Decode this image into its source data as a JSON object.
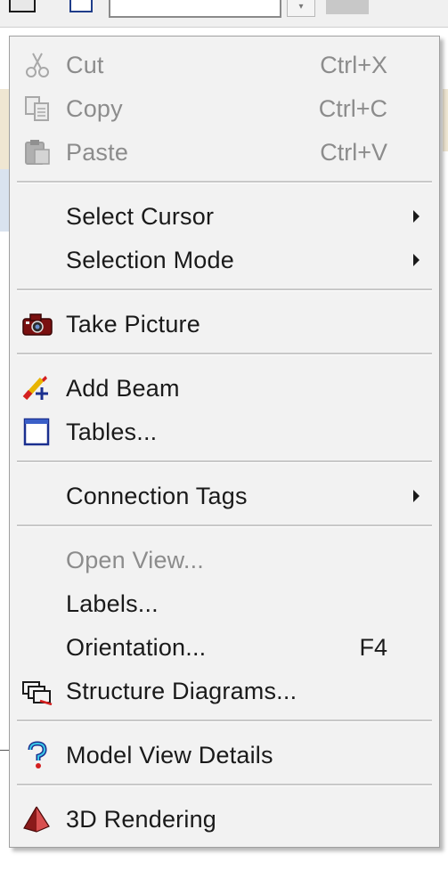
{
  "menu": {
    "items": {
      "cut": {
        "label": "Cut",
        "shortcut": "Ctrl+X"
      },
      "copy": {
        "label": "Copy",
        "shortcut": "Ctrl+C"
      },
      "paste": {
        "label": "Paste",
        "shortcut": "Ctrl+V"
      },
      "select_cursor": {
        "label": "Select Cursor"
      },
      "selection_mode": {
        "label": "Selection Mode"
      },
      "take_picture": {
        "label": "Take Picture"
      },
      "add_beam": {
        "label": "Add Beam"
      },
      "tables": {
        "label": "Tables..."
      },
      "connection_tags": {
        "label": "Connection Tags"
      },
      "open_view": {
        "label": "Open View..."
      },
      "labels": {
        "label": "Labels..."
      },
      "orientation": {
        "label": "Orientation...",
        "shortcut": "F4"
      },
      "structure_diagrams": {
        "label": "Structure Diagrams..."
      },
      "model_view_details": {
        "label": "Model View Details"
      },
      "rendering_3d": {
        "label": "3D Rendering"
      }
    },
    "disabled": [
      "cut",
      "copy",
      "paste",
      "open_view"
    ],
    "icons": {
      "cut": "scissors-icon",
      "copy": "copy-icon",
      "paste": "clipboard-icon",
      "take_picture": "camera-icon",
      "add_beam": "pencil-plus-icon",
      "tables": "table-window-icon",
      "structure_diagrams": "diagram-icon",
      "model_view_details": "help-icon",
      "rendering_3d": "pyramid-icon"
    }
  },
  "colors": {
    "menu_bg": "#f2f2f2",
    "text": "#1a1a1a",
    "disabled_text": "#8c8c8c",
    "separator": "#c8c8c8"
  }
}
